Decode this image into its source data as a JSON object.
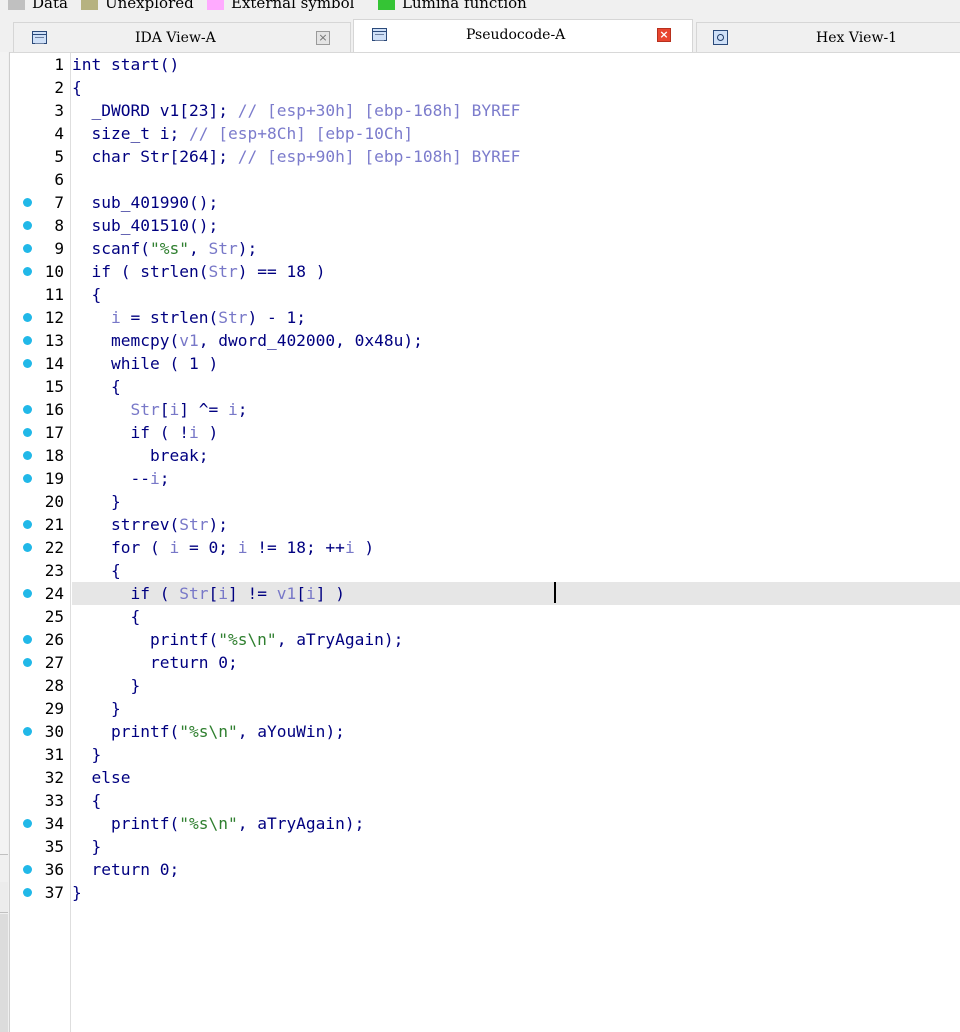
{
  "legend": {
    "items": [
      {
        "label": "Data",
        "color": "#c0c0c0"
      },
      {
        "label": "Unexplored",
        "color": "#b6b280"
      },
      {
        "label": "External symbol",
        "color": "#ffaaff"
      },
      {
        "label": "Lumina function",
        "color": "#35c435"
      }
    ]
  },
  "tabs": [
    {
      "label": "IDA View-A",
      "icon": "listing-icon",
      "active": false,
      "close": "×"
    },
    {
      "label": "Pseudocode-A",
      "icon": "listing-icon",
      "active": true,
      "close": "×"
    },
    {
      "label": "Hex View-1",
      "icon": "hex-icon",
      "active": false
    }
  ],
  "editor": {
    "highlighted_line": 24,
    "colors": {
      "breakpoint_dot": "#21b8e8",
      "highlight": "#e6e6e6"
    },
    "lines": [
      {
        "n": "1",
        "dot": false,
        "text": "int start()"
      },
      {
        "n": "2",
        "dot": false,
        "text": "{"
      },
      {
        "n": "3",
        "dot": false,
        "text": "  _DWORD v1[23]; // [esp+30h] [ebp-168h] BYREF"
      },
      {
        "n": "4",
        "dot": false,
        "text": "  size_t i; // [esp+8Ch] [ebp-10Ch]"
      },
      {
        "n": "5",
        "dot": false,
        "text": "  char Str[264]; // [esp+90h] [ebp-108h] BYREF"
      },
      {
        "n": "6",
        "dot": false,
        "text": ""
      },
      {
        "n": "7",
        "dot": true,
        "text": "  sub_401990();"
      },
      {
        "n": "8",
        "dot": true,
        "text": "  sub_401510();"
      },
      {
        "n": "9",
        "dot": true,
        "text": "  scanf(\"%s\", Str);"
      },
      {
        "n": "10",
        "dot": true,
        "text": "  if ( strlen(Str) == 18 )"
      },
      {
        "n": "11",
        "dot": false,
        "text": "  {"
      },
      {
        "n": "12",
        "dot": true,
        "text": "    i = strlen(Str) - 1;"
      },
      {
        "n": "13",
        "dot": true,
        "text": "    memcpy(v1, dword_402000, 0x48u);"
      },
      {
        "n": "14",
        "dot": true,
        "text": "    while ( 1 )"
      },
      {
        "n": "15",
        "dot": false,
        "text": "    {"
      },
      {
        "n": "16",
        "dot": true,
        "text": "      Str[i] ^= i;"
      },
      {
        "n": "17",
        "dot": true,
        "text": "      if ( !i )"
      },
      {
        "n": "18",
        "dot": true,
        "text": "        break;"
      },
      {
        "n": "19",
        "dot": true,
        "text": "      --i;"
      },
      {
        "n": "20",
        "dot": false,
        "text": "    }"
      },
      {
        "n": "21",
        "dot": true,
        "text": "    strrev(Str);"
      },
      {
        "n": "22",
        "dot": true,
        "text": "    for ( i = 0; i != 18; ++i )"
      },
      {
        "n": "23",
        "dot": false,
        "text": "    {"
      },
      {
        "n": "24",
        "dot": true,
        "text": "      if ( Str[i] != v1[i] )"
      },
      {
        "n": "25",
        "dot": false,
        "text": "      {"
      },
      {
        "n": "26",
        "dot": true,
        "text": "        printf(\"%s\\n\", aTryAgain);"
      },
      {
        "n": "27",
        "dot": true,
        "text": "        return 0;"
      },
      {
        "n": "28",
        "dot": false,
        "text": "      }"
      },
      {
        "n": "29",
        "dot": false,
        "text": "    }"
      },
      {
        "n": "30",
        "dot": true,
        "text": "    printf(\"%s\\n\", aYouWin);"
      },
      {
        "n": "31",
        "dot": false,
        "text": "  }"
      },
      {
        "n": "32",
        "dot": false,
        "text": "  else"
      },
      {
        "n": "33",
        "dot": false,
        "text": "  {"
      },
      {
        "n": "34",
        "dot": true,
        "text": "    printf(\"%s\\n\", aTryAgain);"
      },
      {
        "n": "35",
        "dot": false,
        "text": "  }"
      },
      {
        "n": "36",
        "dot": true,
        "text": "  return 0;"
      },
      {
        "n": "37",
        "dot": true,
        "text": "}"
      }
    ]
  }
}
